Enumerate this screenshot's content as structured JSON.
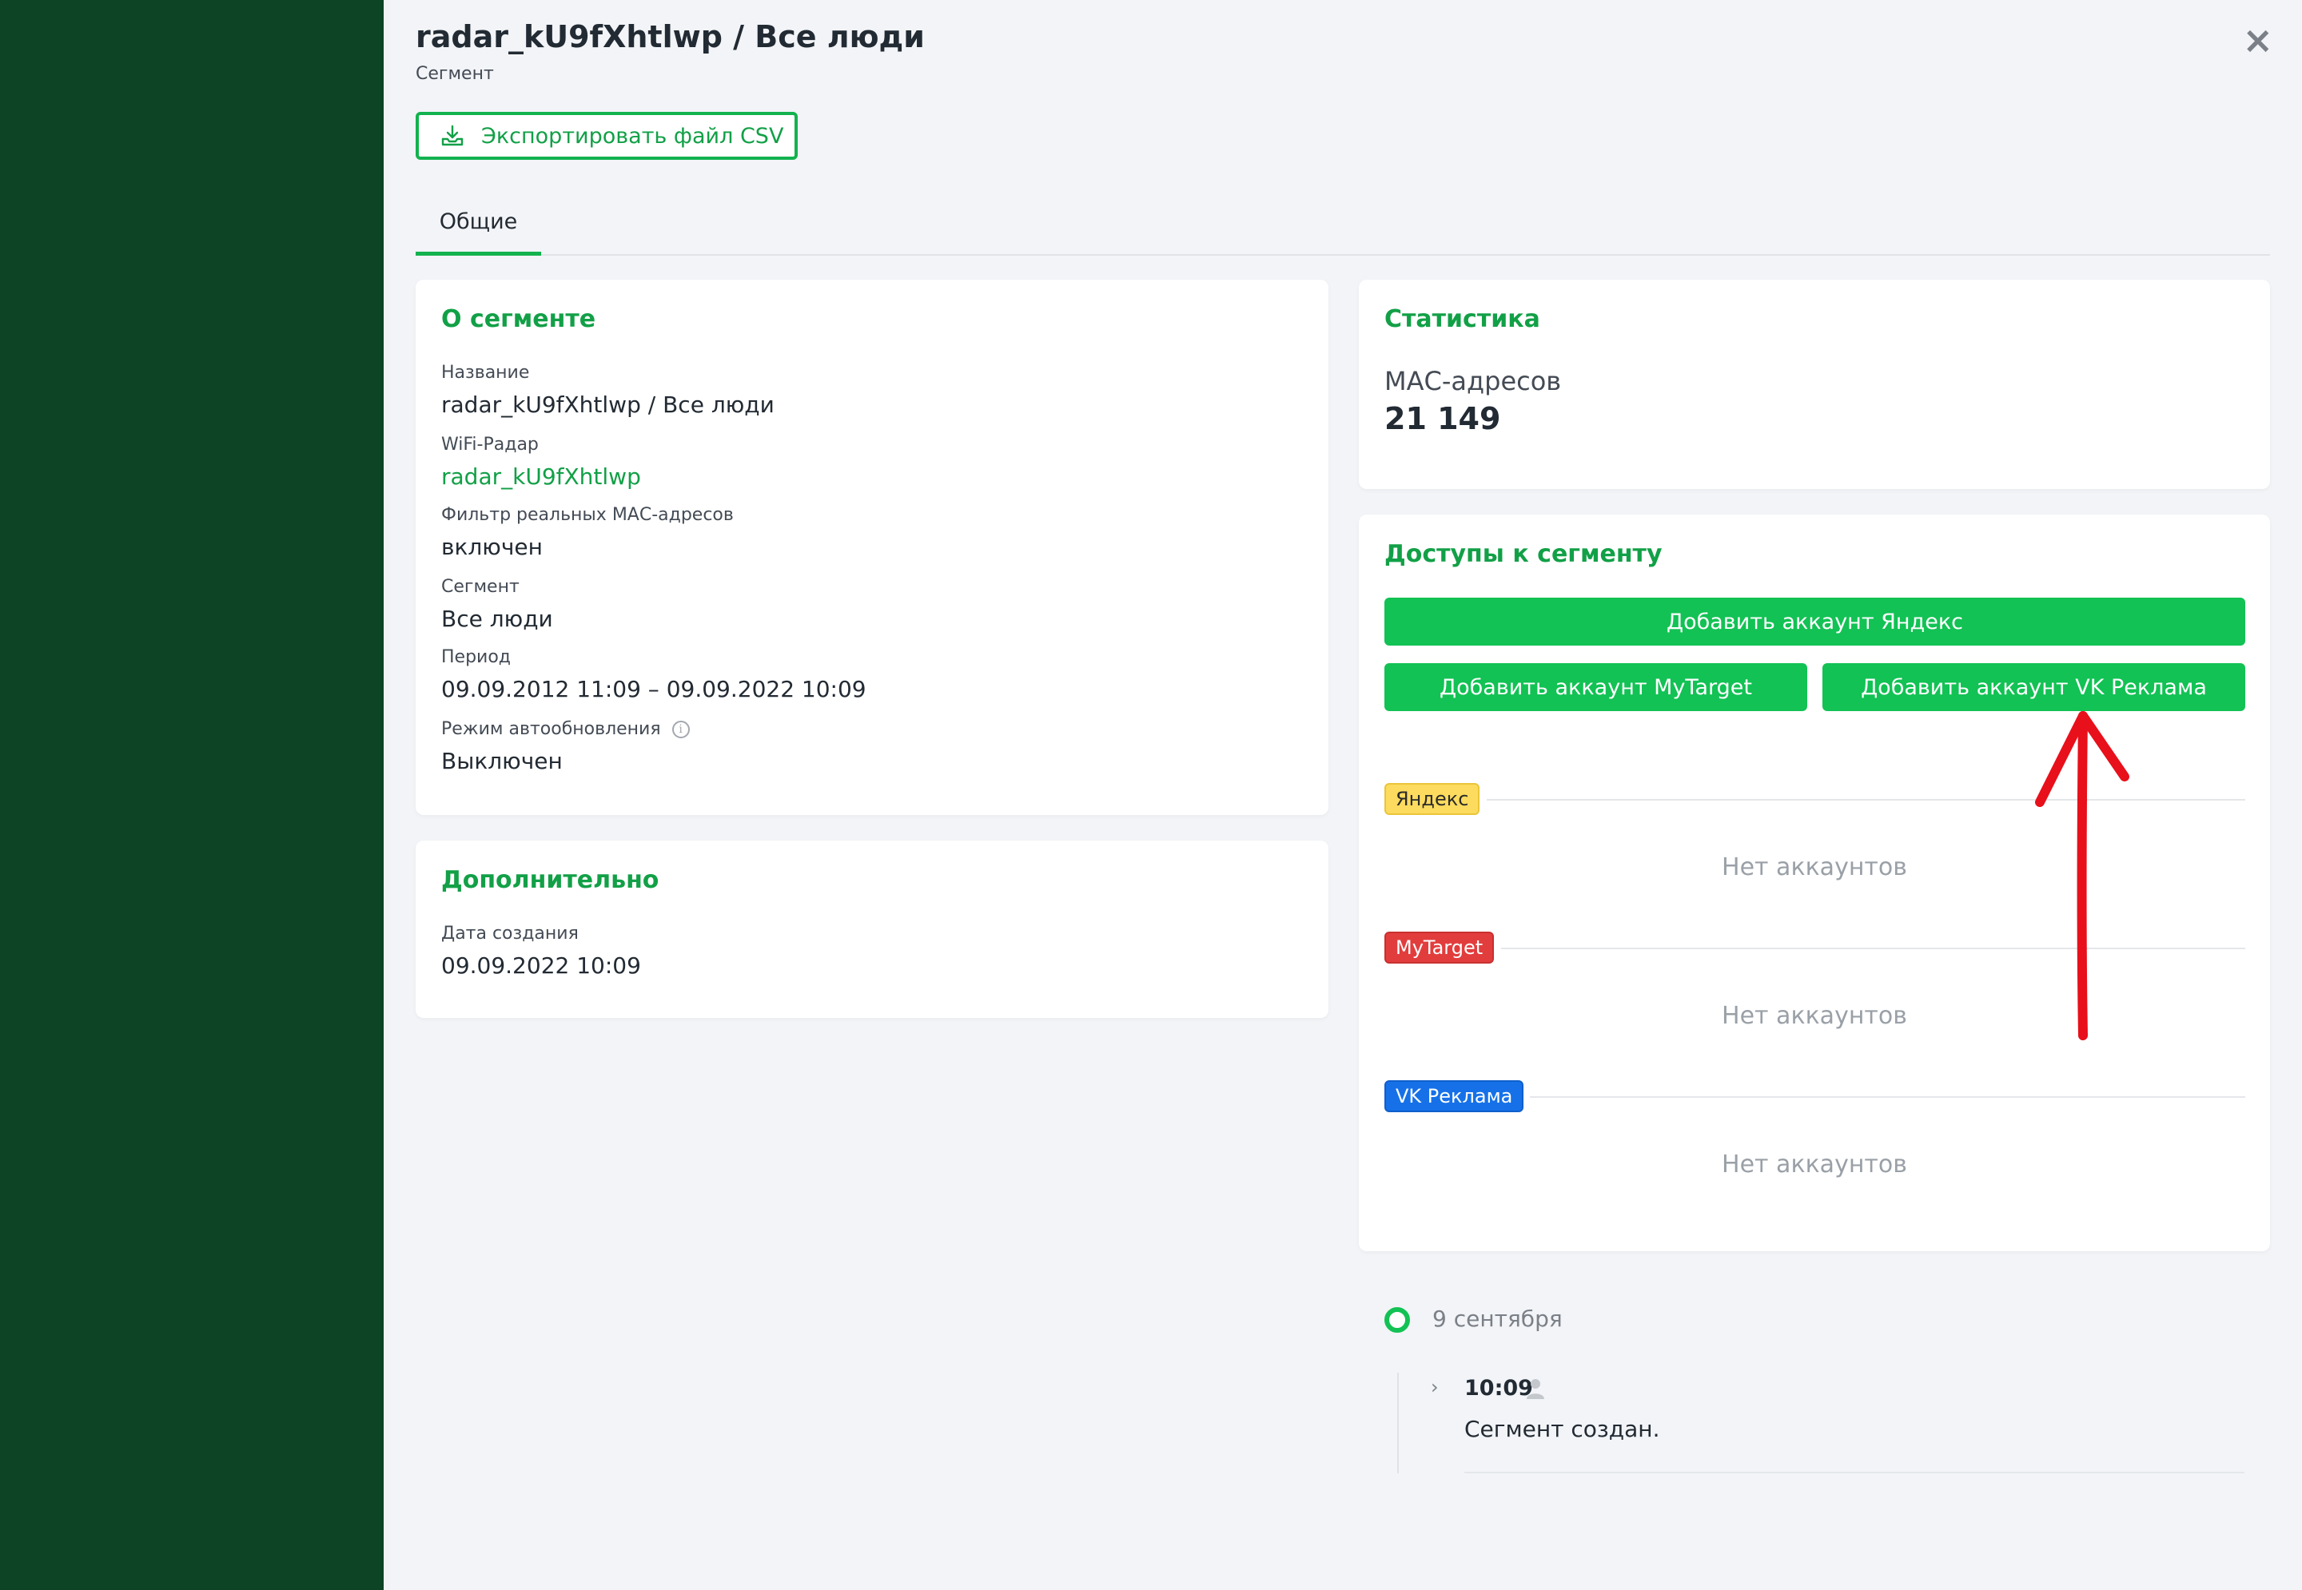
{
  "header": {
    "title": "radar_kU9fXhtlwp / Все люди",
    "subtitle": "Сегмент",
    "close_label": "×",
    "export_label": "Экспортировать файл CSV"
  },
  "tabs": [
    {
      "label": "Общие",
      "active": true
    }
  ],
  "about": {
    "title": "О сегменте",
    "fields": [
      {
        "label": "Название",
        "value": "radar_kU9fXhtlwp / Все люди"
      },
      {
        "label": "WiFi-Радар",
        "value": "radar_kU9fXhtlwp"
      },
      {
        "label": "Фильтр реальных МАС-адресов",
        "value": "включен"
      },
      {
        "label": "Сегмент",
        "value": "Все люди"
      },
      {
        "label": "Период",
        "value": "09.09.2012 11:09 – 09.09.2022 10:09"
      },
      {
        "label": "Режим автообновления",
        "value": "Выключен"
      }
    ]
  },
  "extra": {
    "title": "Дополнительно",
    "fields": [
      {
        "label": "Дата создания",
        "value": "09.09.2022 10:09"
      }
    ]
  },
  "stats": {
    "title": "Статистика",
    "label": "МАС-адресов",
    "value": "21 149"
  },
  "access": {
    "title": "Доступы к сегменту",
    "buttons": {
      "yandex": "Добавить аккаунт Яндекс",
      "mytarget": "Добавить аккаунт MyTarget",
      "vk": "Добавить аккаунт VK Реклама"
    },
    "groups": [
      {
        "badge": "Яндекс",
        "empty": "Нет аккаунтов"
      },
      {
        "badge": "MyTarget",
        "empty": "Нет аккаунтов"
      },
      {
        "badge": "VK Реклама",
        "empty": "Нет аккаунтов"
      }
    ]
  },
  "timeline": {
    "date": "9 сентября",
    "time": "10:09",
    "event": "Сегмент создан."
  },
  "colors": {
    "sidebar": "#0c4425",
    "accent": "#12c254",
    "yandex": "#fcdb5e",
    "mytarget": "#e23d3d",
    "vk": "#1671e8",
    "annotation_arrow": "#e8101a"
  }
}
